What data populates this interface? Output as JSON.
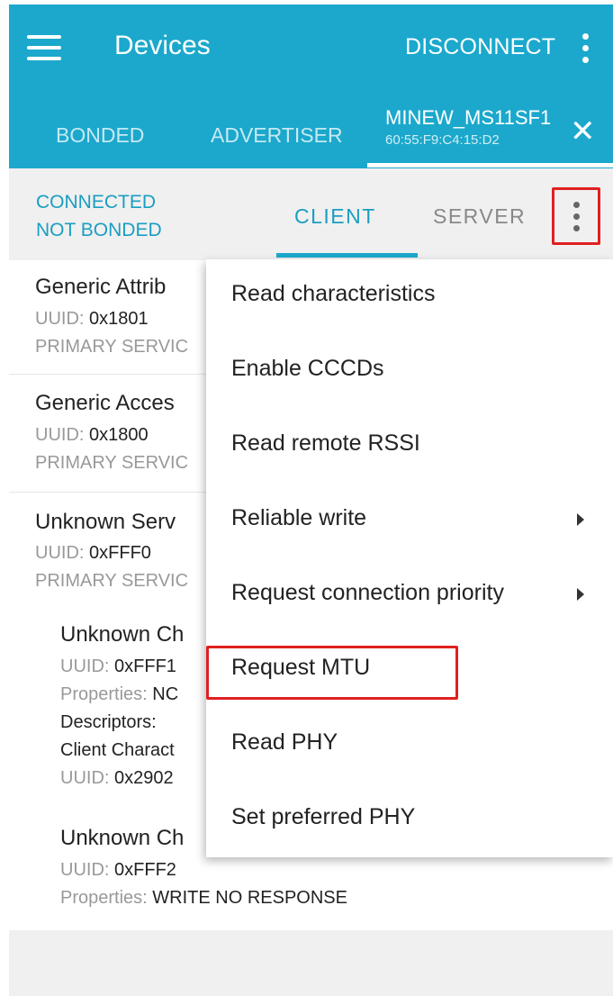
{
  "appbar": {
    "title": "Devices",
    "disconnect_label": "DISCONNECT",
    "menu_icon": "hamburger-menu-icon",
    "overflow_icon": "more-vert-icon"
  },
  "tabs": {
    "bonded": "BONDED",
    "advertiser": "ADVERTISER",
    "device_name": "MINEW_MS11SF1",
    "device_address": "60:55:F9:C4:15:D2",
    "close_icon": "close-icon"
  },
  "subbar": {
    "state_line1": "CONNECTED",
    "state_line2": "NOT BONDED",
    "client": "CLIENT",
    "server": "SERVER"
  },
  "services": [
    {
      "name": "Generic Attrib",
      "uuid_label": "UUID:",
      "uuid": "0x1801",
      "type": "PRIMARY SERVIC"
    },
    {
      "name": "Generic Acces",
      "uuid_label": "UUID:",
      "uuid": "0x1800",
      "type": "PRIMARY SERVIC"
    },
    {
      "name": "Unknown Serv",
      "uuid_label": "UUID:",
      "uuid": "0xFFF0",
      "type": "PRIMARY SERVIC"
    }
  ],
  "characteristics": [
    {
      "name": "Unknown Ch",
      "uuid_label": "UUID:",
      "uuid": "0xFFF1",
      "props_label": "Properties:",
      "props": "NC",
      "descriptors_label": "Descriptors:",
      "descriptor_name": "Client Charact",
      "descriptor_uuid_label": "UUID:",
      "descriptor_uuid": "0x2902"
    },
    {
      "name": "Unknown Ch",
      "uuid_label": "UUID:",
      "uuid": "0xFFF2",
      "props_label": "Properties:",
      "props": "WRITE NO RESPONSE"
    }
  ],
  "popup_menu": {
    "items": [
      {
        "label": "Read characteristics",
        "submenu": false
      },
      {
        "label": "Enable CCCDs",
        "submenu": false
      },
      {
        "label": "Read remote RSSI",
        "submenu": false
      },
      {
        "label": "Reliable write",
        "submenu": true
      },
      {
        "label": "Request connection priority",
        "submenu": true
      },
      {
        "label": "Request MTU",
        "submenu": false
      },
      {
        "label": "Read PHY",
        "submenu": false
      },
      {
        "label": "Set preferred PHY",
        "submenu": false
      }
    ]
  },
  "colors": {
    "appbar": "#1ba8cc",
    "accent": "#1a9ec2",
    "highlight": "#e02020"
  }
}
